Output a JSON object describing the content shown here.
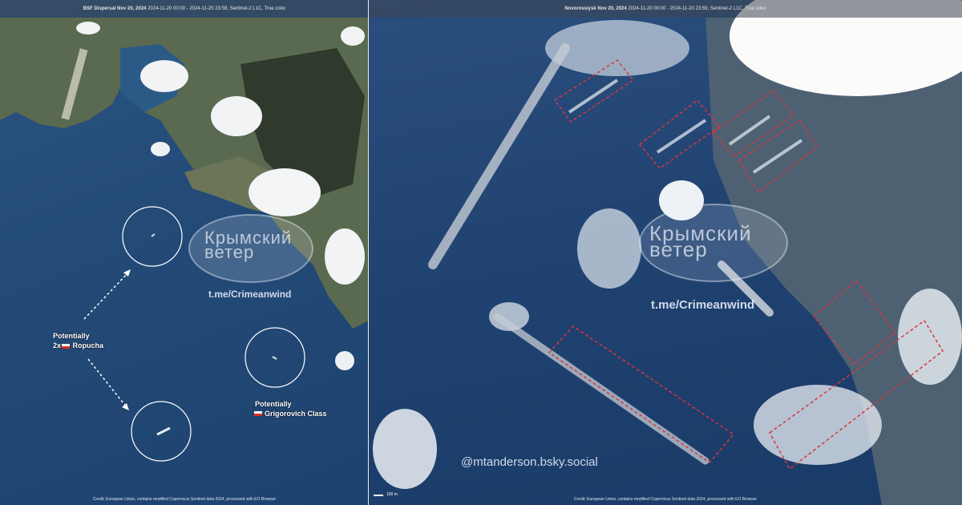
{
  "left_panel": {
    "header_title": "BSF Dispersal Nov 20, 2024",
    "header_detail": "2024-11-20 00:00 - 2024-11-20 23:59, Sentinel-2 L1C, True color",
    "credit": "Credit: European Union, contains modified Copernicus Sentinel data 2024, processed with EO Browser",
    "annotation_ropucha": [
      "Potentially",
      "2x",
      "Ropucha"
    ],
    "annotation_grigorovich": [
      "Potentially",
      "Grigorovich Class"
    ]
  },
  "right_panel": {
    "header_title": "Novorossiysk Nov 20, 2024",
    "header_detail": "2024-11-20 00:00 - 2024-11-20 23:59, Sentinel-2 L1C, True color",
    "credit": "Credit: European Union, contains modified Copernicus Sentinel data 2024, processed with EO Browser",
    "scale_label": "100 m",
    "handle": "@mtanderson.bsky.social"
  },
  "watermark": {
    "line1": "Крымский",
    "line2": "ветер",
    "url": "t.me/Crimeanwind"
  },
  "colors": {
    "sea": "#244b78",
    "land": "#5d6b52",
    "cloud": "#f2f4f6",
    "annotation_box": "#d9363e",
    "flag_red": "#d52b1e"
  }
}
